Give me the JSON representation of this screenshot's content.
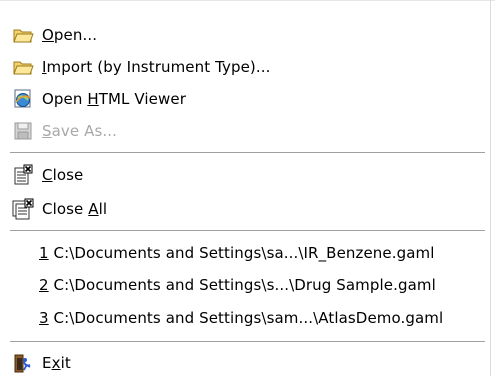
{
  "menu": {
    "open": {
      "pre": "",
      "u": "O",
      "post": "pen..."
    },
    "import": {
      "pre": "",
      "u": "I",
      "post": "mport (by Instrument Type)..."
    },
    "html_viewer": {
      "pre": "Open ",
      "u": "H",
      "post": "TML Viewer"
    },
    "save_as": {
      "pre": "",
      "u": "S",
      "post": "ave As..."
    },
    "close": {
      "pre": "",
      "u": "C",
      "post": "lose"
    },
    "close_all": {
      "pre": "Close ",
      "u": "A",
      "post": "ll"
    },
    "recent": [
      {
        "num": "1",
        "path": " C:\\Documents and Settings\\sa...\\IR_Benzene.gaml"
      },
      {
        "num": "2",
        "path": " C:\\Documents and Settings\\s...\\Drug Sample.gaml"
      },
      {
        "num": "3",
        "path": " C:\\Documents and Settings\\sam...\\AtlasDemo.gaml"
      }
    ],
    "exit": {
      "pre": "E",
      "u": "x",
      "post": "it"
    }
  },
  "icons": {
    "open": "folder-open-icon",
    "import": "folder-open-icon",
    "html_viewer": "browser-globe-icon",
    "save_as": "floppy-disk-icon",
    "close": "close-document-icon",
    "close_all": "close-all-documents-icon",
    "exit": "exit-door-icon"
  }
}
